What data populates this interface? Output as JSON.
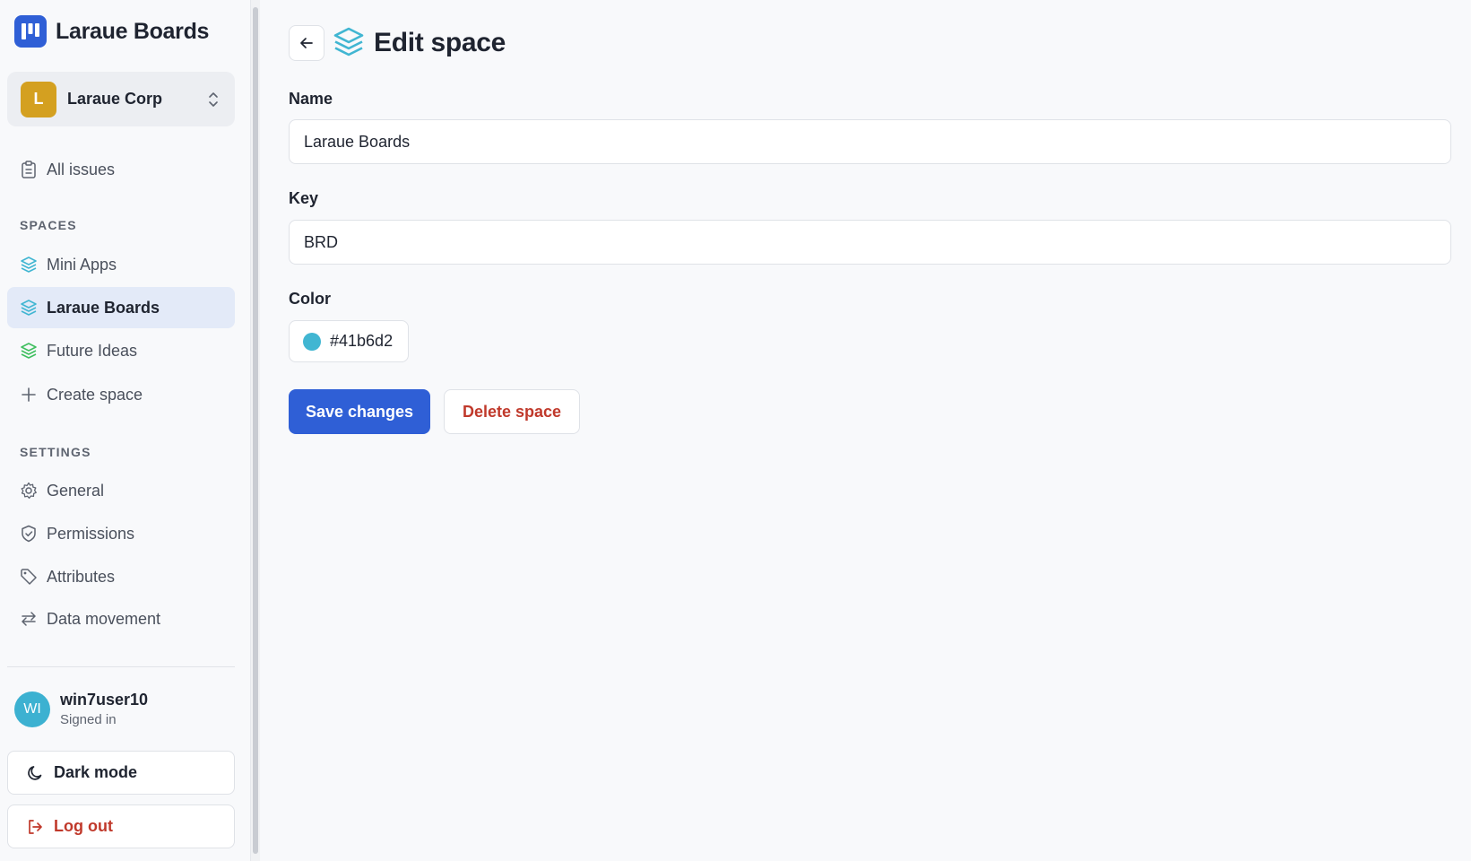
{
  "app": {
    "name": "Laraue Boards",
    "brand_color": "#2f5fd6"
  },
  "org": {
    "initial": "L",
    "name": "Laraue Corp",
    "avatar_color": "#d4a020"
  },
  "nav": {
    "all_issues": "All issues",
    "spaces_heading": "SPACES",
    "spaces": [
      {
        "label": "Mini Apps",
        "icon": "layers-icon",
        "color": "#41b6d2",
        "active": false
      },
      {
        "label": "Laraue Boards",
        "icon": "layers-icon",
        "color": "#41b6d2",
        "active": true
      },
      {
        "label": "Future Ideas",
        "icon": "layers-icon",
        "color": "#3fbf5f",
        "active": false
      }
    ],
    "create_space": "Create space",
    "settings_heading": "SETTINGS",
    "settings": [
      {
        "label": "General",
        "icon": "gear-icon"
      },
      {
        "label": "Permissions",
        "icon": "shield-icon"
      },
      {
        "label": "Attributes",
        "icon": "tag-icon"
      },
      {
        "label": "Data movement",
        "icon": "arrows-icon"
      }
    ]
  },
  "user": {
    "initials": "WI",
    "name": "win7user10",
    "status": "Signed in",
    "avatar_color": "#3cb1d1"
  },
  "footer": {
    "dark_mode": "Dark mode",
    "log_out": "Log out"
  },
  "page": {
    "title": "Edit space",
    "name_label": "Name",
    "name_value": "Laraue Boards",
    "key_label": "Key",
    "key_value": "BRD",
    "color_label": "Color",
    "color_value": "#41b6d2",
    "save_label": "Save changes",
    "delete_label": "Delete space"
  }
}
